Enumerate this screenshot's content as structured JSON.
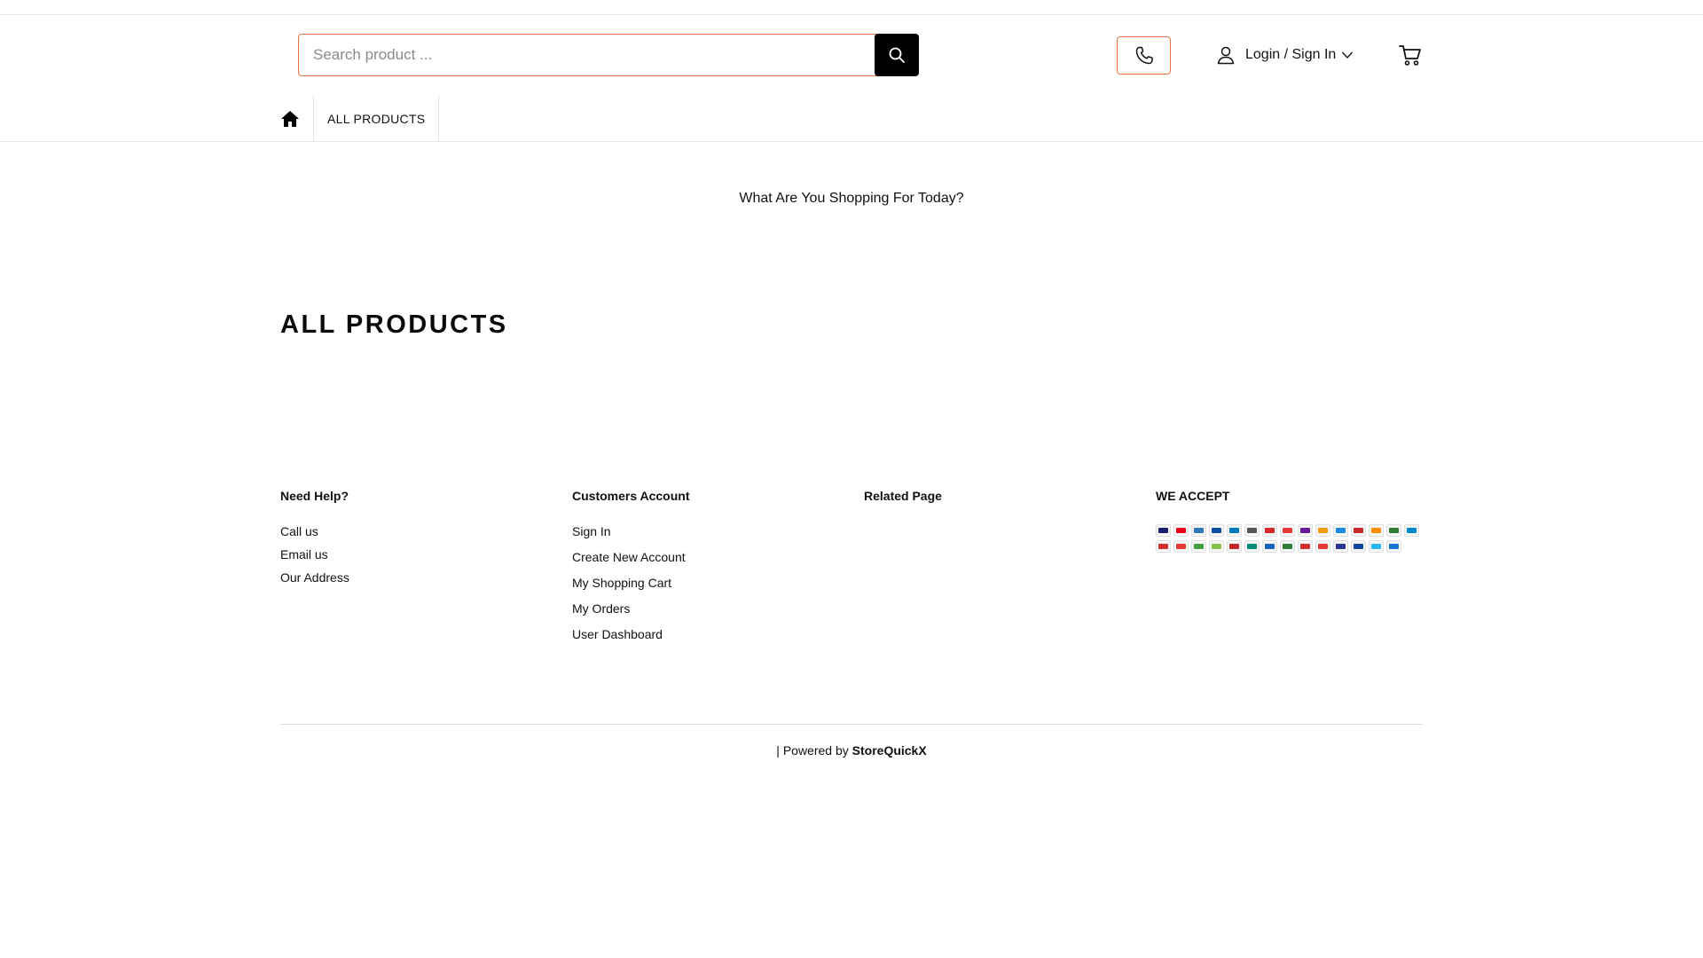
{
  "header": {
    "search": {
      "placeholder": "Search product ...",
      "value": ""
    },
    "login_label": "Login / Sign In",
    "accent": "#e8733f"
  },
  "nav": {
    "items": [
      {
        "label": "ALL PRODUCTS"
      }
    ]
  },
  "tagline": "What Are You Shopping For Today?",
  "section_title": "ALL PRODUCTS",
  "footer": {
    "need_help": {
      "heading": "Need Help?",
      "links": [
        "Call us",
        "Email us",
        "Our Address"
      ]
    },
    "customers_account": {
      "heading": "Customers Account",
      "links": [
        "Sign In",
        "Create New Account",
        "My Shopping Cart",
        "My Orders",
        "User Dashboard"
      ]
    },
    "related_page": {
      "heading": "Related Page"
    },
    "we_accept": {
      "heading": "WE ACCEPT",
      "methods": [
        {
          "icon": "visa-icon",
          "color": "#1a1f71"
        },
        {
          "icon": "mastercard-icon",
          "color": "#eb001b"
        },
        {
          "icon": "amex-icon",
          "color": "#2e77bb"
        },
        {
          "icon": "jcb-icon",
          "color": "#0b4ea2"
        },
        {
          "icon": "diners-icon",
          "color": "#0079be"
        },
        {
          "icon": "payment-icon",
          "color": "#555555"
        },
        {
          "icon": "payment-icon",
          "color": "#d7262a"
        },
        {
          "icon": "payment-icon",
          "color": "#e53935"
        },
        {
          "icon": "payment-icon",
          "color": "#6a1b9a"
        },
        {
          "icon": "payment-icon",
          "color": "#f39c12"
        },
        {
          "icon": "payment-icon",
          "color": "#1e88e5"
        },
        {
          "icon": "payment-icon",
          "color": "#c62828"
        },
        {
          "icon": "payment-icon",
          "color": "#fb8c00"
        },
        {
          "icon": "payment-icon",
          "color": "#2e7d32"
        },
        {
          "icon": "payment-icon",
          "color": "#0288d1"
        },
        {
          "icon": "payment-icon",
          "color": "#d32f2f"
        },
        {
          "icon": "payment-icon",
          "color": "#e53935"
        },
        {
          "icon": "payment-icon",
          "color": "#43a047"
        },
        {
          "icon": "payment-icon",
          "color": "#8bc34a"
        },
        {
          "icon": "payment-icon",
          "color": "#c62828"
        },
        {
          "icon": "payment-icon",
          "color": "#00897b"
        },
        {
          "icon": "payment-icon",
          "color": "#1565c0"
        },
        {
          "icon": "payment-icon",
          "color": "#2e7d32"
        },
        {
          "icon": "payment-icon",
          "color": "#d32f2f"
        },
        {
          "icon": "payment-icon",
          "color": "#e53935"
        },
        {
          "icon": "payment-icon",
          "color": "#283593"
        },
        {
          "icon": "payment-icon",
          "color": "#0d47a1"
        },
        {
          "icon": "payment-icon",
          "color": "#29b6f6"
        },
        {
          "icon": "payment-icon",
          "color": "#1976d2"
        }
      ]
    },
    "powered_prefix": "| Powered by",
    "powered_brand": "StoreQuickX"
  }
}
